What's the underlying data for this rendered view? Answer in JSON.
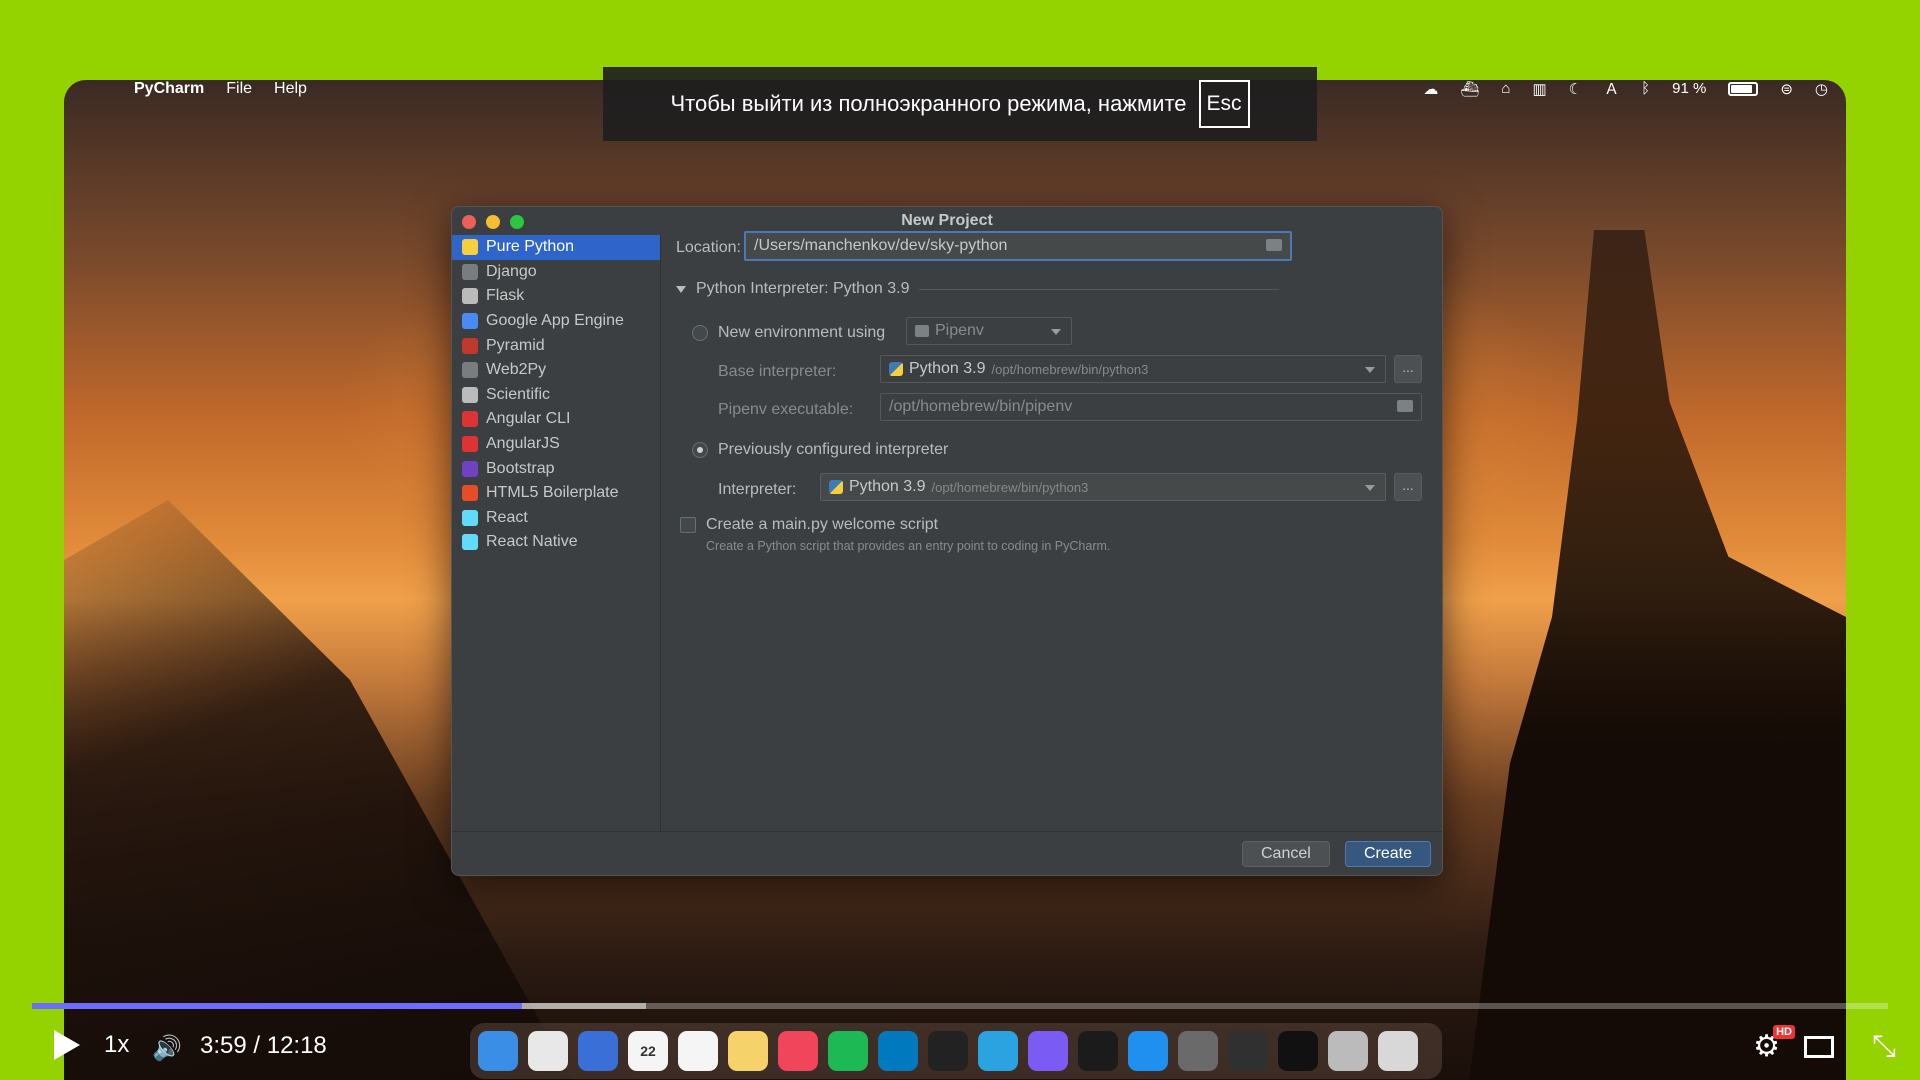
{
  "menubar": {
    "app_name": "PyCharm",
    "menus": [
      "File",
      "Help"
    ],
    "battery": "91 %"
  },
  "fullscreen_notice": {
    "text": "Чтобы выйти из полноэкранного режима, нажмите",
    "key": "Esc"
  },
  "dialog": {
    "title": "New Project",
    "sidebar": [
      {
        "label": "Pure Python",
        "icon": "python-icon",
        "color": "#f6cf3f",
        "selected": true
      },
      {
        "label": "Django",
        "icon": "django-icon",
        "color": "#7a7d7f"
      },
      {
        "label": "Flask",
        "icon": "flask-icon",
        "color": "#bbbbbb"
      },
      {
        "label": "Google App Engine",
        "icon": "google-app-engine-icon",
        "color": "#4a8af4"
      },
      {
        "label": "Pyramid",
        "icon": "pyramid-icon",
        "color": "#c0392b"
      },
      {
        "label": "Web2Py",
        "icon": "web2py-icon",
        "color": "#7a7d7f"
      },
      {
        "label": "Scientific",
        "icon": "scientific-icon",
        "color": "#bbbbbb"
      },
      {
        "label": "Angular CLI",
        "icon": "angular-cli-icon",
        "color": "#dd3333"
      },
      {
        "label": "AngularJS",
        "icon": "angularjs-icon",
        "color": "#dd3333"
      },
      {
        "label": "Bootstrap",
        "icon": "bootstrap-icon",
        "color": "#6f42c1"
      },
      {
        "label": "HTML5 Boilerplate",
        "icon": "html5-icon",
        "color": "#e44d26"
      },
      {
        "label": "React",
        "icon": "react-icon",
        "color": "#61dafb"
      },
      {
        "label": "React Native",
        "icon": "react-native-icon",
        "color": "#61dafb"
      }
    ],
    "location": {
      "label": "Location:",
      "value": "/Users/manchenkov/dev/sky-python"
    },
    "interpreter_section": "Python Interpreter: Python 3.9",
    "new_env": {
      "label": "New environment using",
      "tool": "Pipenv",
      "base_label": "Base interpreter:",
      "base_value": "Python 3.9",
      "base_path": "/opt/homebrew/bin/python3",
      "pipenv_label": "Pipenv executable:",
      "pipenv_value": "/opt/homebrew/bin/pipenv",
      "selected": false
    },
    "prev_configured": {
      "label": "Previously configured interpreter",
      "selected": true,
      "interpreter_label": "Interpreter:",
      "interpreter_value": "Python 3.9",
      "interpreter_path": "/opt/homebrew/bin/python3"
    },
    "welcome_script": {
      "label": "Create a main.py welcome script",
      "description": "Create a Python script that provides an entry point to coding in PyCharm.",
      "checked": false
    },
    "dots": "...",
    "buttons": {
      "cancel": "Cancel",
      "create": "Create"
    }
  },
  "player": {
    "speed": "1x",
    "time": "3:59 / 12:18",
    "progress_played": 0.264,
    "progress_buffered": 0.331,
    "hd_badge": "HD"
  },
  "dock": [
    {
      "name": "finder",
      "color": "#3a8ee6"
    },
    {
      "name": "chrome",
      "color": "#e8e8e8"
    },
    {
      "name": "safari",
      "color": "#3a6fd8"
    },
    {
      "name": "calendar",
      "color": "#f5f5f5",
      "text": "22"
    },
    {
      "name": "reminders",
      "color": "#f5f5f5"
    },
    {
      "name": "notes",
      "color": "#f5d36a"
    },
    {
      "name": "music",
      "color": "#f0455a"
    },
    {
      "name": "spotify",
      "color": "#1db954"
    },
    {
      "name": "trello",
      "color": "#0079bf"
    },
    {
      "name": "zoom",
      "color": "#222"
    },
    {
      "name": "telegram",
      "color": "#2aa3e0"
    },
    {
      "name": "messenger",
      "color": "#7a5cf5"
    },
    {
      "name": "terminal",
      "color": "#1b1b1b"
    },
    {
      "name": "app-store",
      "color": "#1f8ff0"
    },
    {
      "name": "system-preferences",
      "color": "#6a6a6a"
    },
    {
      "name": "obs",
      "color": "#303030"
    },
    {
      "name": "pycharm",
      "color": "#111"
    },
    {
      "name": "downloads",
      "color": "#bbb"
    },
    {
      "name": "trash",
      "color": "#d8d8d8"
    }
  ]
}
